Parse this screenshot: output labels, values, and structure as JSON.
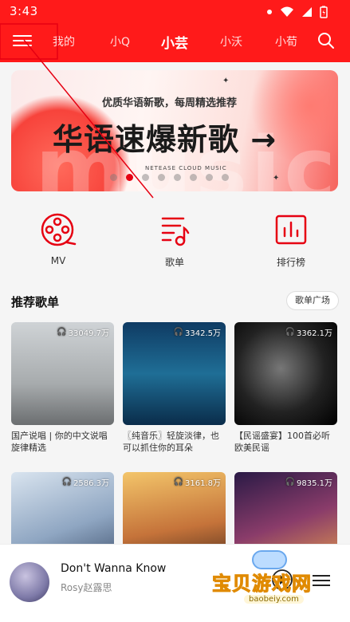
{
  "status_bar": {
    "time": "3:43"
  },
  "nav": {
    "tabs": [
      {
        "label": "我的",
        "active": false
      },
      {
        "label": "小Q",
        "active": false
      },
      {
        "label": "小芸",
        "active": true
      },
      {
        "label": "小沃",
        "active": false
      },
      {
        "label": "小荀",
        "active": false
      }
    ]
  },
  "banner": {
    "subtitle": "优质华语新歌，每周精选推荐",
    "headline": "华语速爆新歌 →",
    "brand": "NETEASE CLOUD MUSIC",
    "bg_word": "music",
    "page_count": 8,
    "current_page": 2
  },
  "quick_entries": [
    {
      "label": "MV",
      "icon": "film-reel-icon"
    },
    {
      "label": "歌单",
      "icon": "playlist-note-icon"
    },
    {
      "label": "排行榜",
      "icon": "chart-bars-icon"
    }
  ],
  "section": {
    "title": "推荐歌单",
    "more_label": "歌单广场"
  },
  "playlists": [
    {
      "count": "33049.7万",
      "title": "国产说唱 | 你的中文说唱旋律精选"
    },
    {
      "count": "3342.5万",
      "title": "〖纯音乐〗轻旋淡律，也可以抓住你的耳朵"
    },
    {
      "count": "3362.1万",
      "title": "【民谣盛宴】100首必听欧美民谣"
    },
    {
      "count": "2586.3万",
      "title": ""
    },
    {
      "count": "3161.8万",
      "title": ""
    },
    {
      "count": "9835.1万",
      "title": ""
    }
  ],
  "player": {
    "song": "Don't Wanna Know",
    "artist": "Rosy赵露思"
  },
  "watermark": {
    "text": "宝贝游戏网",
    "url": "baobeiy.com"
  },
  "colors": {
    "brand_red": "#ff1a1a",
    "accent_red": "#e60012"
  }
}
